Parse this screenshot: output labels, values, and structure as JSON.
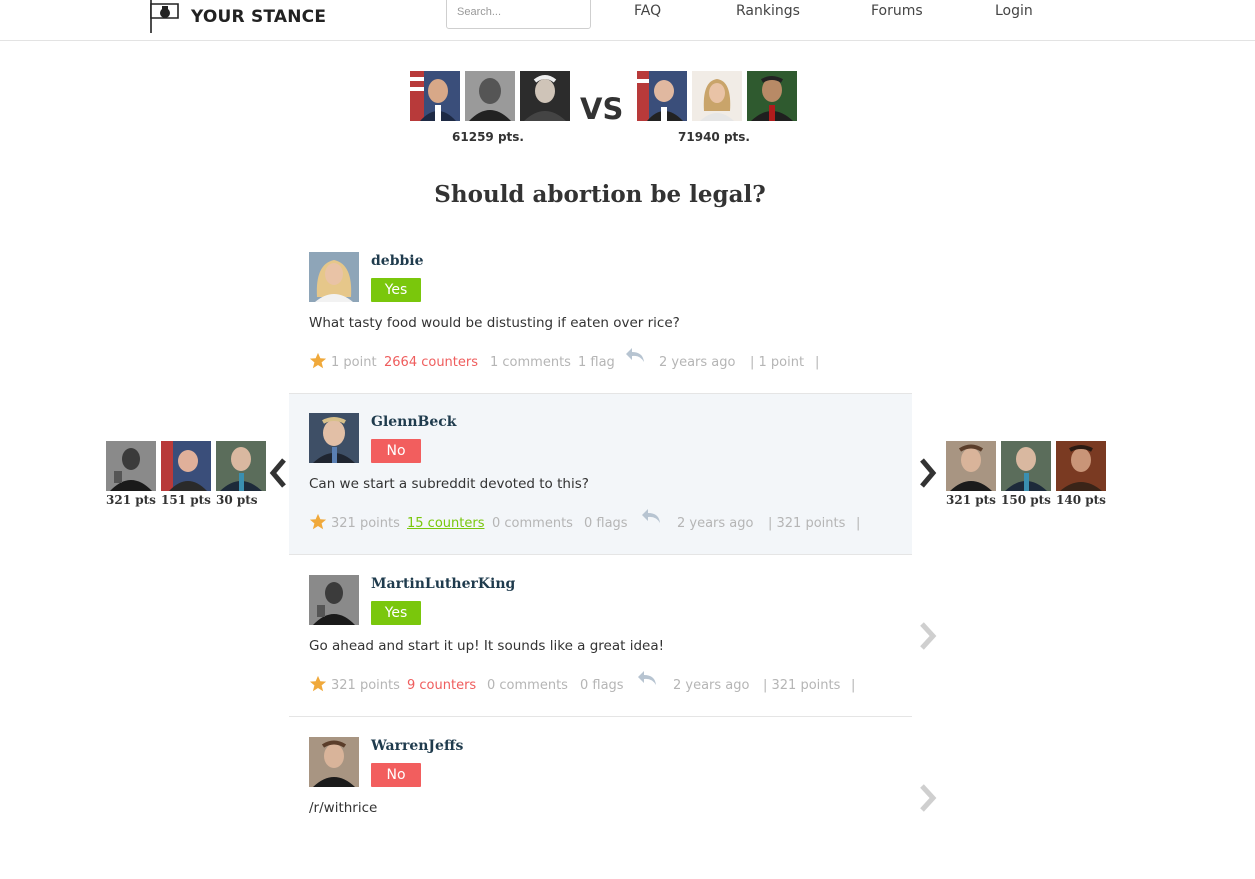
{
  "brand": {
    "name": "YOUR STANCE"
  },
  "search": {
    "placeholder": "Search..."
  },
  "nav": [
    "FAQ",
    "Rankings",
    "Forums",
    "Login"
  ],
  "match": {
    "left_points": "61259 pts.",
    "right_points": "71940 pts.",
    "vs": "VS"
  },
  "question": "Should abortion be legal?",
  "left_rail": {
    "points": [
      "321 pts",
      "151 pts",
      "30 pts"
    ]
  },
  "right_rail": {
    "points": [
      "321 pts",
      "150 pts",
      "140 pts"
    ]
  },
  "colors": {
    "yes": "#7ac70c",
    "no": "#f25e5e",
    "counter_red": "#ef5d5d",
    "meta_gray": "#b5b5b5",
    "highlight_bg": "#f3f6f9"
  },
  "posts": [
    {
      "user": "debbie",
      "stance": "Yes",
      "text": "What tasty food would be distusting if eaten over rice?",
      "points": "1 point",
      "counters": "2664 counters",
      "comments": "1 comments",
      "flags": "1 flag",
      "age": "2 years ago",
      "tail_points": "| 1 point",
      "sep": "|"
    },
    {
      "user": "GlennBeck",
      "stance": "No",
      "text": "Can we start a subreddit devoted to this?",
      "points": "321 points",
      "counters": "15 counters",
      "comments": "0 comments",
      "flags": "0 flags",
      "age": "2 years ago",
      "tail_points": "| 321 points",
      "sep": "|"
    },
    {
      "user": "MartinLutherKing",
      "stance": "Yes",
      "text": "Go ahead and start it up! It sounds like a great idea!",
      "points": "321 points",
      "counters": "9 counters",
      "comments": "0 comments",
      "flags": "0 flags",
      "age": "2 years ago",
      "tail_points": "| 321 points",
      "sep": "|"
    },
    {
      "user": "WarrenJeffs",
      "stance": "No",
      "text": "/r/withrice"
    }
  ]
}
